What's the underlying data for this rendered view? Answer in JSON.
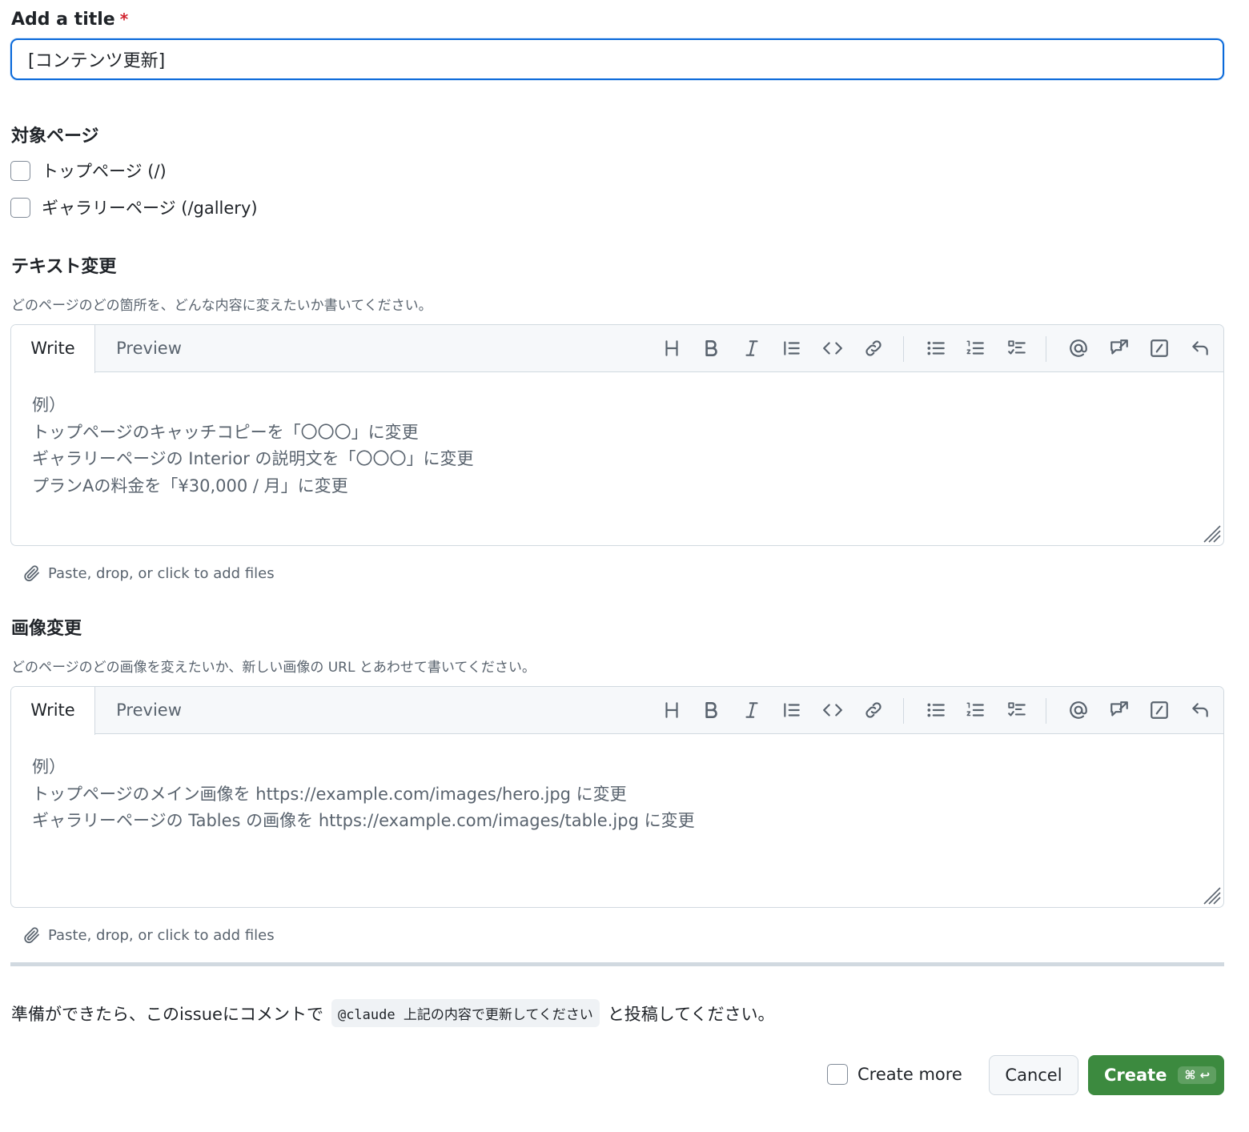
{
  "title_field": {
    "label": "Add a title",
    "required_mark": "*",
    "value": "[コンテンツ更新]"
  },
  "target_pages": {
    "heading": "対象ページ",
    "options": [
      {
        "label": "トップページ (/)",
        "checked": false
      },
      {
        "label": "ギャラリーページ (/gallery)",
        "checked": false
      }
    ]
  },
  "text_change": {
    "heading": "テキスト変更",
    "description": "どのページのどの箇所を、どんな内容に変えたいか書いてください。",
    "tabs": {
      "write": "Write",
      "preview": "Preview"
    },
    "placeholder_lines": [
      "例）",
      "トップページのキャッチコピーを「〇〇〇」に変更",
      "ギャラリーページの Interior の説明文を「〇〇〇」に変更",
      "プランAの料金を「¥30,000 / 月」に変更"
    ],
    "attach_text": "Paste, drop, or click to add files"
  },
  "image_change": {
    "heading": "画像変更",
    "description": "どのページのどの画像を変えたいか、新しい画像の URL とあわせて書いてください。",
    "tabs": {
      "write": "Write",
      "preview": "Preview"
    },
    "placeholder_lines": [
      "例）",
      "トップページのメイン画像を https://example.com/images/hero.jpg に変更",
      "ギャラリーページの Tables の画像を https://example.com/images/table.jpg に変更"
    ],
    "attach_text": "Paste, drop, or click to add files"
  },
  "toolbar_icons": [
    "heading-icon",
    "bold-icon",
    "italic-icon",
    "quote-icon",
    "code-icon",
    "link-icon",
    "unordered-list-icon",
    "ordered-list-icon",
    "task-list-icon",
    "mention-icon",
    "cross-reference-icon",
    "slash-command-icon",
    "undo-icon"
  ],
  "footer_note": {
    "before": "準備ができたら、このissueにコメントで",
    "code": "@claude 上記の内容で更新してください",
    "after": "と投稿してください。"
  },
  "actions": {
    "create_more": "Create more",
    "cancel": "Cancel",
    "create": "Create",
    "shortcut": "⌘ ↩"
  },
  "colors": {
    "focus_border": "#0969da",
    "create_button": "#3c8a3f",
    "required": "#d1242f"
  }
}
